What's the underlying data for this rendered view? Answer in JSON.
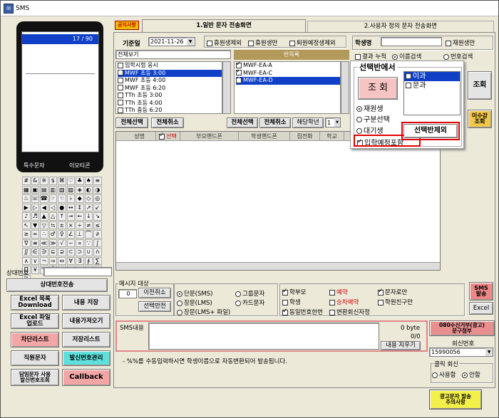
{
  "window": {
    "title": "SMS"
  },
  "phone": {
    "counter": "17 / 90",
    "bottom_left": "특수문자",
    "bottom_right": "이모티콘"
  },
  "symbols": [
    "#",
    "&",
    "※",
    "$",
    "⌘",
    "♡",
    "♣",
    "♠",
    "≡",
    "▦",
    "▣",
    "▤",
    "▥",
    "▧",
    "▨",
    "◈",
    "◐",
    "◑",
    "♨",
    "☏",
    "☎",
    "☞",
    "☜",
    "♭",
    "◆",
    "◇",
    "◎",
    "▶",
    "▷",
    "◀",
    "◁",
    "●",
    "↔",
    "↕",
    "↗",
    "↙",
    "♪",
    "♬",
    "▲",
    "△",
    "↑",
    "→",
    "←",
    "↓",
    "↘",
    "↖",
    "▼",
    "▽",
    "≒",
    "±",
    "×",
    "÷",
    "≠",
    "≤",
    "≥",
    "∞",
    "∴",
    "♂",
    "♀",
    "∠",
    "⊥",
    "⌒",
    "∂",
    "∇",
    "≡",
    "≪",
    "≫",
    "√",
    "∽",
    "∝",
    "∵",
    "∫",
    "∬",
    "∈",
    "∋",
    "⊆",
    "⊇",
    "⊂",
    "⊃",
    "∪",
    "∩",
    "∧",
    "∨",
    "¬",
    "⇒",
    "⇔",
    "∀",
    "∃",
    "∮",
    "∑",
    "∏",
    "￥",
    "℃",
    "Å",
    "￠",
    "￡",
    "‰",
    "№",
    "㏇",
    "™"
  ],
  "left": {
    "phone_label": "상대번호",
    "btn_phone_send": "상대번호전송",
    "btn_excel_download": "Excel 목록\nDownload",
    "btn_save_content": "내용 저장",
    "btn_excel_upload": "Excel 파일\n업로드",
    "btn_load_content": "내용가져오기",
    "btn_block_list": "차단리스트",
    "btn_save_list": "저장리스트",
    "btn_special": "직원문자",
    "btn_sender_mgmt": "발신번호관리",
    "btn_teacher_send": "담임문자 사용\n발신번호조회",
    "btn_callback": "Callback"
  },
  "tabs": {
    "badge": "공지사항",
    "tab1": "1.일반 문자 전송화면",
    "tab2": "2.사용자 정의 문자 전송화면"
  },
  "filters": {
    "date_label": "기준일",
    "date_value": "2021-11-26",
    "chk_exclude_done": "휴원생제외",
    "chk_only_done": "휴원생만",
    "chk_exclude_leave": "퇴원예정생제외",
    "student_label": "학생명",
    "chk_attend_only": "재원생만",
    "view_mode": "전체보기",
    "class_header": "반목록",
    "chk_result_all": "결과 누적",
    "radio_name_search": "이름검색",
    "radio_number_search": "번호검색"
  },
  "class_list": [
    {
      "label": "입학시험 응시",
      "checked": false,
      "sel": false
    },
    {
      "label": "MWF 초등 3:00",
      "checked": true,
      "sel": true
    },
    {
      "label": "MWF 초등 4:00",
      "checked": false,
      "sel": false
    },
    {
      "label": "MWF 초등 6:20",
      "checked": false,
      "sel": false
    },
    {
      "label": "TTh 초등 3:00",
      "checked": false,
      "sel": false
    },
    {
      "label": "TTh 초등 4:00",
      "checked": false,
      "sel": false
    },
    {
      "label": "TTh 중등 6:20",
      "checked": false,
      "sel": false
    }
  ],
  "class_list2": [
    {
      "label": "MWF-EA-A",
      "checked": true,
      "sel": false
    },
    {
      "label": "MWF-EA-C",
      "checked": true,
      "sel": false
    },
    {
      "label": "MWF-EA-D",
      "checked": true,
      "sel": true
    }
  ],
  "popup": {
    "title": "선택반에서",
    "search_btn": "조 회",
    "radio_current": "재원생",
    "radio_category": "구분선택",
    "radio_waiting": "대기생",
    "chk_include": "입학예정포함",
    "opt1": "이과",
    "opt2": "문과",
    "exclude_btn": "선택반제외"
  },
  "grid_buttons": {
    "select_all": "전체선택",
    "deselect_all": "전체취소",
    "select_all2": "전체선택",
    "deselect_all2": "전체취소",
    "grade_label": "해당학년",
    "grade_value": "1"
  },
  "grid_headers": [
    "성명",
    "선택",
    "부모핸드폰",
    "학생핸드폰",
    "집전화",
    "학교"
  ],
  "right_buttons": {
    "search": "조회",
    "teacher_cut": "미수강\n조회"
  },
  "message": {
    "target_label": "메시지 대상",
    "count": "0",
    "btn_clear": "이전취소",
    "btn_sel_confirm": "선택반전",
    "radio_sms": "단문(SMS)",
    "radio_lms": "장문(LMS)",
    "radio_lms_file": "장문(LMS+ 파일)",
    "radio_group": "그룹문자",
    "radio_card": "카드문자",
    "chk_parent": "학부모",
    "chk_student": "학생",
    "chk_same": "동일번호한번",
    "chk_reserve": "예약",
    "chk_auto": "승차예약",
    "chk_reply": "변환회신자정",
    "chk_only_text": "문자로만",
    "chk_class_friends": "학원친구만",
    "btn_sms_send": "SMS\n발송",
    "btn_excel": "Excel"
  },
  "sms_content": {
    "label": "SMS내용",
    "bytes": "0 byte",
    "count": "0/0",
    "btn_clear_content": "내용 지우기",
    "note": "- %%를 수동입력하시면 학생이름으로 자동변환되어 발송됩니다."
  },
  "sender": {
    "btn_receive_reject": "080수신거부(광고)\n문구첨부",
    "label": "회신번호",
    "number": "15990056",
    "clock_label": "클릭 회신",
    "radio_use": "사용함",
    "radio_notuse": "안함",
    "btn_ad_notice": "광고문자 발송\n주의사항"
  }
}
